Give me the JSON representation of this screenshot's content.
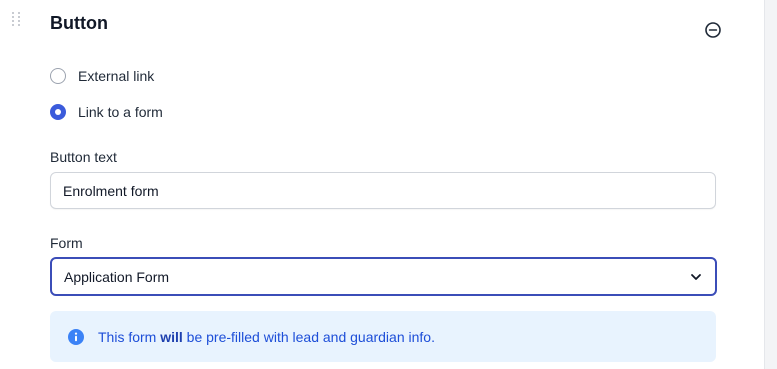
{
  "section": {
    "title": "Button"
  },
  "link_type": {
    "options": [
      {
        "label": "External link",
        "selected": false
      },
      {
        "label": "Link to a form",
        "selected": true
      }
    ]
  },
  "button_text": {
    "label": "Button text",
    "value": "Enrolment form"
  },
  "form": {
    "label": "Form",
    "selected": "Application Form"
  },
  "info": {
    "text_before": "This form ",
    "text_bold": "will",
    "text_after": " be pre-filled with lead and guardian info."
  },
  "colors": {
    "accent": "#3b5bdb",
    "info_bg": "#e8f3fe",
    "info_text": "#1d4ed8"
  },
  "icons": {
    "drag": "drag-handle-icon",
    "collapse": "minus-circle-icon",
    "select": "chevron-down-icon",
    "info": "info-circle-icon"
  }
}
